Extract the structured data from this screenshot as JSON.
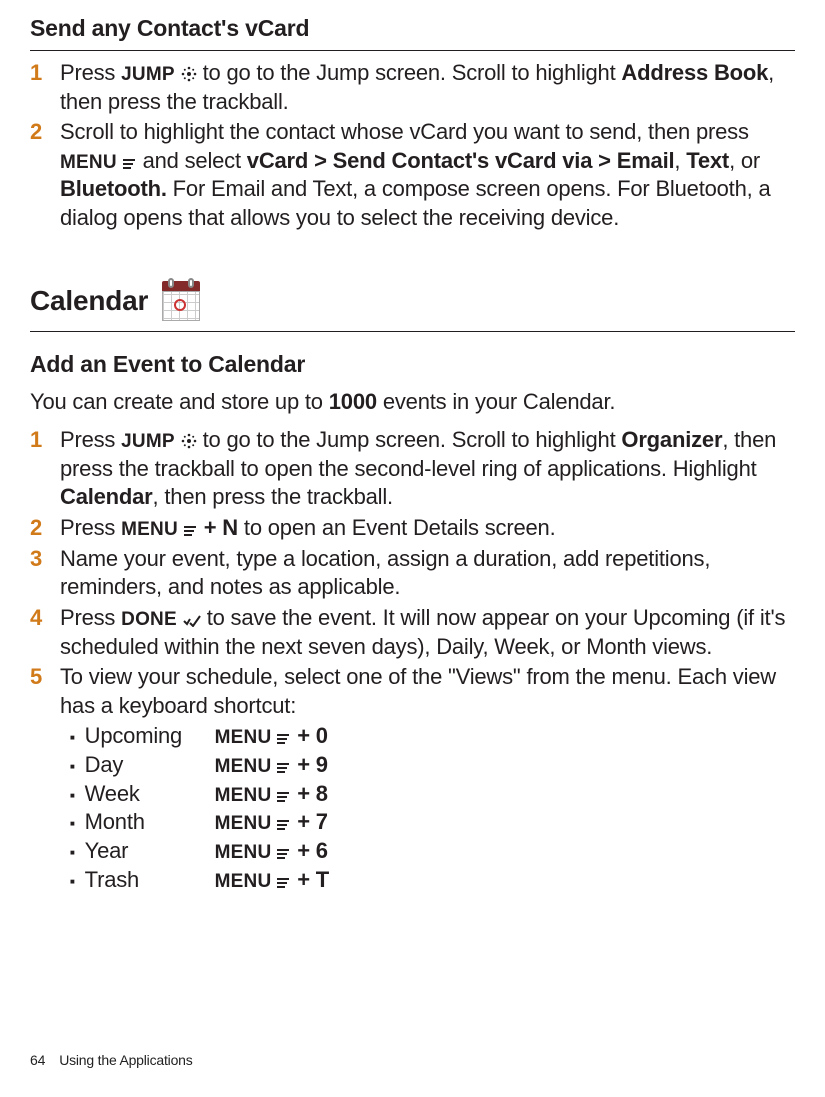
{
  "section1": {
    "title": "Send any Contact's vCard",
    "steps": [
      {
        "num": "1",
        "p1a": "Press ",
        "key1": "JUMP",
        "p1b": " to go to the Jump screen. Scroll to highlight ",
        "b1": "Address Book",
        "p1c": ", then press the trackball."
      },
      {
        "num": "2",
        "p2a": "Scroll to highlight the contact whose vCard you want to send, then press ",
        "key2": "MENU",
        "p2b": " and select ",
        "b2a": "vCard > Send Contact's vCard via > Email",
        "p2c": ", ",
        "b2b": "Text",
        "p2d": ", or ",
        "b2c": "Bluetooth.",
        "p2e": " For Email and Text, a compose screen opens. For Bluetooth, a dialog opens that allows you to select the receiving device."
      }
    ]
  },
  "calendar_hdr": "Calendar",
  "section2": {
    "title": "Add an Event to Calendar",
    "intro_a": "You can create and store up to ",
    "intro_b": "1000",
    "intro_c": " events in your Calendar.",
    "steps": [
      {
        "num": "1",
        "a": "Press ",
        "key": "JUMP",
        "b": " to go to the Jump screen. Scroll to highlight ",
        "bold1": "Organizer",
        "c": ", then press the trackball to open the second-level ring of applications. Highlight ",
        "bold2": "Calendar",
        "d": ", then press the trackball."
      },
      {
        "num": "2",
        "a": "Press ",
        "key": "MENU",
        "plus": " + N",
        "b": " to open an Event Details screen."
      },
      {
        "num": "3",
        "a": "Name your event, type a location, assign a duration, add repetitions, reminders, and notes as applicable."
      },
      {
        "num": "4",
        "a": "Press ",
        "key": "DONE",
        "b": " to save the event. It will now appear on your Upcoming (if it's scheduled within the next seven days), Daily, Week, or Month views."
      },
      {
        "num": "5",
        "a": "To view your schedule, select one of the \"Views\" from the menu. Each view has a keyboard shortcut:"
      }
    ],
    "shortcuts": [
      {
        "label": "Upcoming",
        "menu": "MENU",
        "key": " + 0"
      },
      {
        "label": "Day",
        "menu": "MENU",
        "key": " + 9"
      },
      {
        "label": "Week",
        "menu": "MENU",
        "key": " + 8"
      },
      {
        "label": "Month",
        "menu": "MENU",
        "key": " + 7"
      },
      {
        "label": "Year",
        "menu": "MENU",
        "key": " + 6"
      },
      {
        "label": "Trash",
        "menu": "MENU",
        "key": " + T"
      }
    ]
  },
  "footer": {
    "page": "64",
    "section": "Using the Applications"
  }
}
